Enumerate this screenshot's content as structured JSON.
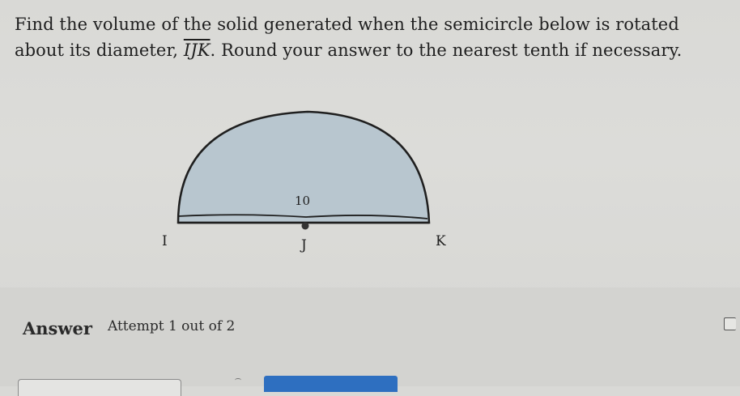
{
  "question": {
    "text_before": "Find the volume of the solid generated when the semicircle below is rotated about its diameter, ",
    "diameter_name": "IJK",
    "text_after": ". Round your answer to the nearest tenth if necessary."
  },
  "figure": {
    "radius_label": "10",
    "point_left": "I",
    "point_center": "J",
    "point_right": "K",
    "fill_color": "#b8c6cf",
    "stroke_color": "#1f1f1f"
  },
  "answer": {
    "label": "Answer",
    "attempt_text": "Attempt 1 out of 2",
    "input_value": "",
    "submit_color": "#2e6fc0"
  }
}
